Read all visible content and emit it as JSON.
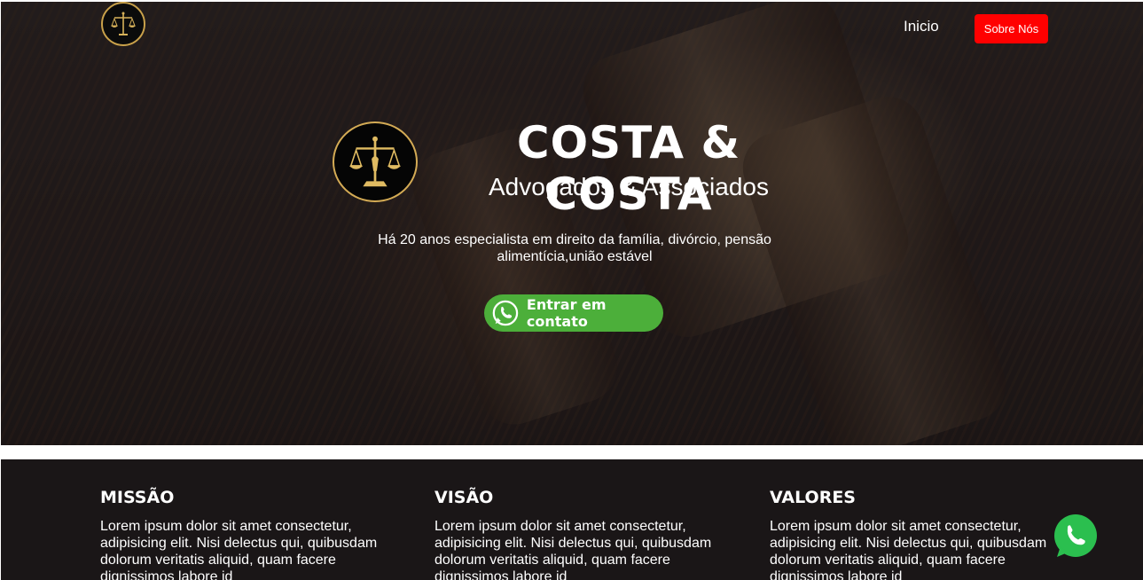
{
  "nav": {
    "home_label": "Inicio",
    "about_label": "Sobre Nós"
  },
  "hero": {
    "title": "COSTA & COSTA",
    "subtitle": "Advogados & Associados",
    "tagline": "Há 20 anos especialista em direito da família, divórcio, pensão alimentícia,união estável",
    "cta_label": "Entrar em contato",
    "cta_icon": "whatsapp-icon"
  },
  "info": {
    "columns": [
      {
        "title": "MISSÃO",
        "text": "Lorem ipsum dolor sit amet consectetur, adipisicing elit. Nisi delectus qui, quibusdam dolorum veritatis aliquid, quam facere dignissimos labore id"
      },
      {
        "title": "VISÃO",
        "text": "Lorem ipsum dolor sit amet consectetur, adipisicing elit. Nisi delectus qui, quibusdam dolorum veritatis aliquid, quam facere dignissimos labore id"
      },
      {
        "title": "VALORES",
        "text": "Lorem ipsum dolor sit amet consectetur, adipisicing elit. Nisi delectus qui, quibusdam dolorum veritatis aliquid, quam facere dignissimos labore id"
      }
    ]
  },
  "colors": {
    "accent_red": "#ff0000",
    "whatsapp_green": "#4caf3a",
    "gold": "#c9a14a",
    "dark_section": "#1a1617"
  }
}
